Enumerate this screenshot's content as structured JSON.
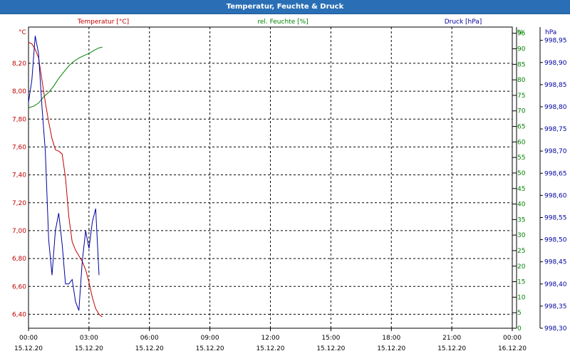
{
  "window": {
    "title": "Temperatur, Feuchte & Druck"
  },
  "chart_data": {
    "type": "line",
    "title": "Temperatur, Feuchte & Druck",
    "grid": true,
    "x": {
      "range": [
        "15.12.20 00:00",
        "16.12.20 00:00"
      ],
      "ticks": [
        {
          "time": "00:00",
          "date": "15.12.20"
        },
        {
          "time": "03:00",
          "date": "15.12.20"
        },
        {
          "time": "06:00",
          "date": "15.12.20"
        },
        {
          "time": "09:00",
          "date": "15.12.20"
        },
        {
          "time": "12:00",
          "date": "15.12.20"
        },
        {
          "time": "15:00",
          "date": "15.12.20"
        },
        {
          "time": "18:00",
          "date": "15.12.20"
        },
        {
          "time": "21:00",
          "date": "15.12.20"
        },
        {
          "time": "00:00",
          "date": "16.12.20"
        }
      ]
    },
    "axes": {
      "temperature": {
        "label": "Temperatur [°C]",
        "unit": "°C",
        "side": "left",
        "color": "#c00000",
        "range": [
          6.3,
          8.46
        ],
        "ticks": [
          "8,20",
          "8,00",
          "7,80",
          "7,60",
          "7,40",
          "7,20",
          "7,00",
          "6,80",
          "6,60",
          "6,40"
        ],
        "tick_values": [
          8.2,
          8.0,
          7.8,
          7.6,
          7.4,
          7.2,
          7.0,
          6.8,
          6.6,
          6.4
        ]
      },
      "humidity": {
        "label": "rel. Feuchte [%]",
        "unit": "%",
        "side": "right",
        "color": "#008000",
        "range": [
          0,
          97
        ],
        "ticks": [
          "95",
          "90",
          "85",
          "80",
          "75",
          "70",
          "65",
          "60",
          "55",
          "50",
          "45",
          "40",
          "35",
          "30",
          "25",
          "20",
          "15",
          "10",
          "5",
          "0"
        ],
        "tick_values": [
          95,
          90,
          85,
          80,
          75,
          70,
          65,
          60,
          55,
          50,
          45,
          40,
          35,
          30,
          25,
          20,
          15,
          10,
          5,
          0
        ]
      },
      "pressure": {
        "label": "Druck [hPa]",
        "unit": "hPa",
        "side": "right",
        "color": "#0000a0",
        "range": [
          998.3,
          998.98
        ],
        "ticks": [
          "998,95",
          "998,90",
          "998,85",
          "998,80",
          "998,75",
          "998,70",
          "998,65",
          "998,60",
          "998,55",
          "998,50",
          "998,45",
          "998,40",
          "998,35",
          "998,30"
        ],
        "tick_values": [
          998.95,
          998.9,
          998.85,
          998.8,
          998.75,
          998.7,
          998.65,
          998.6,
          998.55,
          998.5,
          998.45,
          998.4,
          998.35,
          998.3
        ]
      }
    },
    "series": [
      {
        "name": "Temperatur [°C]",
        "axis": "temperature",
        "color": "#c00000",
        "points": [
          [
            "00:00",
            8.35
          ],
          [
            "00:10",
            8.34
          ],
          [
            "00:20",
            8.3
          ],
          [
            "00:30",
            8.24
          ],
          [
            "00:40",
            8.08
          ],
          [
            "00:50",
            7.92
          ],
          [
            "01:00",
            7.78
          ],
          [
            "01:10",
            7.66
          ],
          [
            "01:20",
            7.58
          ],
          [
            "01:30",
            7.57
          ],
          [
            "01:40",
            7.55
          ],
          [
            "01:50",
            7.38
          ],
          [
            "02:00",
            7.1
          ],
          [
            "02:10",
            6.92
          ],
          [
            "02:20",
            6.86
          ],
          [
            "02:30",
            6.82
          ],
          [
            "02:40",
            6.78
          ],
          [
            "02:50",
            6.72
          ],
          [
            "03:00",
            6.63
          ],
          [
            "03:10",
            6.52
          ],
          [
            "03:20",
            6.44
          ],
          [
            "03:30",
            6.4
          ],
          [
            "03:40",
            6.38
          ]
        ]
      },
      {
        "name": "rel. Feuchte [%]",
        "axis": "humidity",
        "color": "#008000",
        "points": [
          [
            "00:00",
            71.0
          ],
          [
            "00:15",
            71.5
          ],
          [
            "00:30",
            72.5
          ],
          [
            "00:45",
            74.5
          ],
          [
            "01:00",
            76.0
          ],
          [
            "01:15",
            78.0
          ],
          [
            "01:30",
            80.5
          ],
          [
            "01:45",
            82.5
          ],
          [
            "02:00",
            84.5
          ],
          [
            "02:15",
            86.0
          ],
          [
            "02:30",
            87.0
          ],
          [
            "02:45",
            87.8
          ],
          [
            "03:00",
            88.5
          ],
          [
            "03:15",
            89.5
          ],
          [
            "03:30",
            90.3
          ],
          [
            "03:40",
            90.5
          ]
        ]
      },
      {
        "name": "Druck [hPa]",
        "axis": "pressure",
        "color": "#0000a0",
        "points": [
          [
            "00:00",
            998.81
          ],
          [
            "00:10",
            998.86
          ],
          [
            "00:20",
            998.96
          ],
          [
            "00:30",
            998.92
          ],
          [
            "00:40",
            998.8
          ],
          [
            "00:50",
            998.7
          ],
          [
            "01:00",
            998.5
          ],
          [
            "01:10",
            998.42
          ],
          [
            "01:20",
            998.52
          ],
          [
            "01:30",
            998.56
          ],
          [
            "01:40",
            998.49
          ],
          [
            "01:50",
            998.4
          ],
          [
            "02:00",
            998.4
          ],
          [
            "02:10",
            998.41
          ],
          [
            "02:20",
            998.36
          ],
          [
            "02:30",
            998.34
          ],
          [
            "02:40",
            998.45
          ],
          [
            "02:50",
            998.52
          ],
          [
            "03:00",
            998.48
          ],
          [
            "03:10",
            998.54
          ],
          [
            "03:20",
            998.57
          ],
          [
            "03:30",
            998.42
          ]
        ]
      }
    ]
  }
}
